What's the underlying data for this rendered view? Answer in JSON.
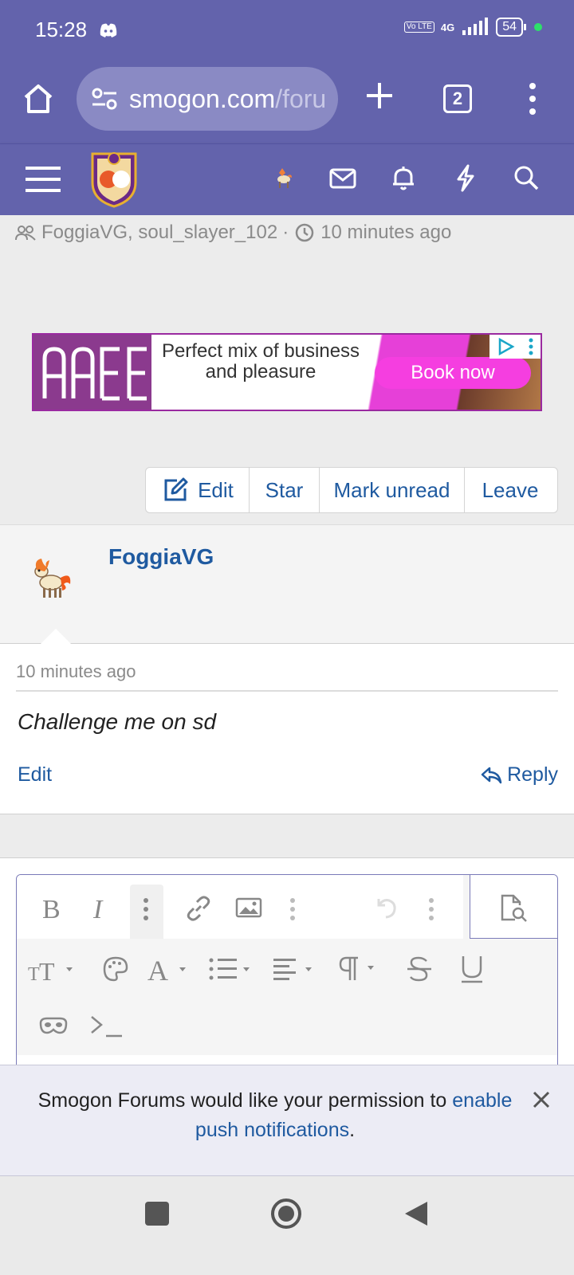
{
  "status_bar": {
    "time": "15:28",
    "volte_label": "Vo LTE",
    "network": "4G",
    "battery": "54"
  },
  "browser": {
    "url_host": "smogon.com",
    "url_rest": "/foru",
    "tab_count": "2"
  },
  "thread": {
    "participants": "FoggiaVG, soul_slayer_102",
    "separator": "·",
    "last_activity": "10 minutes ago"
  },
  "ad": {
    "tagline": "Perfect mix of business and pleasure",
    "cta": "Book now"
  },
  "actions": {
    "edit": "Edit",
    "star": "Star",
    "mark_unread": "Mark unread",
    "leave": "Leave"
  },
  "post": {
    "author": "FoggiaVG",
    "time": "10 minutes ago",
    "text": "Challenge me on sd",
    "edit_label": "Edit",
    "reply_label": "Reply"
  },
  "notice": {
    "text": "Smogon Forums would like your permission to ",
    "link": "enable push notifications",
    "suffix": "."
  },
  "colors": {
    "header": "#6363ac",
    "link": "#1f5aa0",
    "ad_accent": "#f53ee0"
  }
}
